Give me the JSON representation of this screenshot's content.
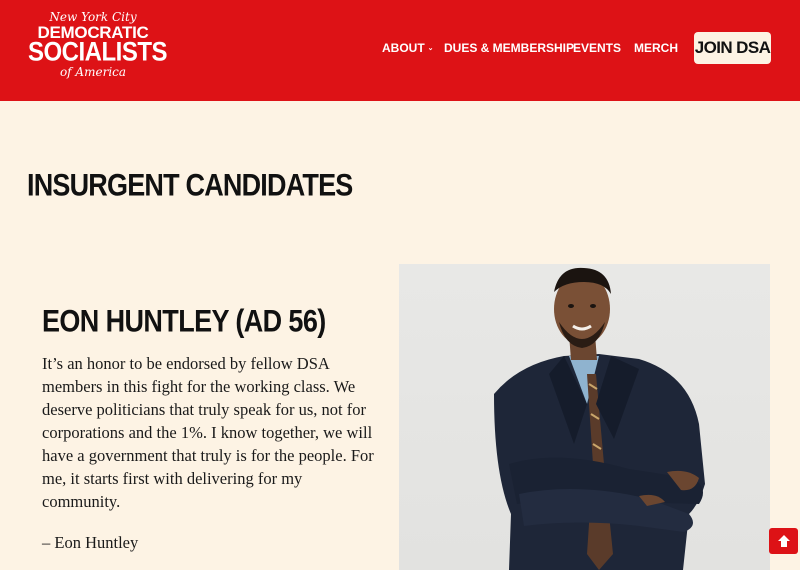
{
  "header": {
    "logo": {
      "line1": "New York City",
      "line2": "DEMOCRATIC",
      "line3": "SOCIALISTS",
      "line4": "of America"
    },
    "nav": [
      {
        "label": "ABOUT",
        "has_dropdown": true
      },
      {
        "label": "DUES & MEMBERSHIP"
      },
      {
        "label": "EVENTS"
      },
      {
        "label": "MERCH"
      }
    ],
    "join_button": "JOIN DSA"
  },
  "main": {
    "page_title": "INSURGENT CANDIDATES",
    "candidate": {
      "name": "EON HUNTLEY (AD 56)",
      "quote": "It’s an honor to be endorsed by fellow DSA members in this fight for the working class. We deserve politicians that truly speak for us, not for corporations and the 1%. I know together, we will have a government that truly is for the people. For me, it starts first with delivering for my community.",
      "attribution": "– Eon Huntley"
    }
  },
  "colors": {
    "brand_red": "#dd1216",
    "background": "#fdf3e4",
    "text": "#111111"
  },
  "icons": {
    "scroll_top": "arrow-up-icon",
    "dropdown": "chevron-down-icon"
  }
}
